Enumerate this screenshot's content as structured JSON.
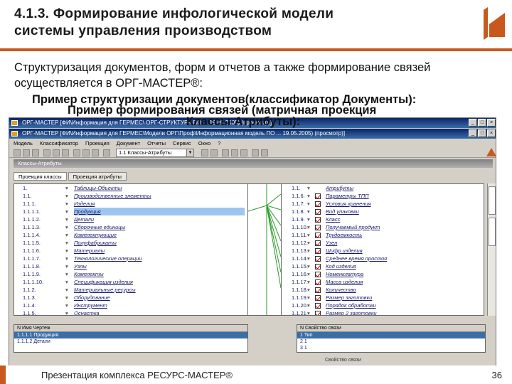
{
  "header": {
    "title_line1": "4.1.3. Формирование инфологической модели",
    "title_line2": "системы управления производством"
  },
  "intro": "Структуризация документов, форм и отчетов а также формирование связей осуществляется в ОРГ-МАСТЕР®:",
  "headings": {
    "a": "Пример структуризации документов(классификатор Документы):",
    "b": "Пример формирования связей (матричная проекция",
    "c": "Классы-Атрибуты):"
  },
  "window": {
    "title1": "ОРГ-МАСТЕР [ФИ\\Информация для ГЕРМЕС\\ ОРГ-СТРУКТУРА ПО ... 19.05.2005) (просмотр)]",
    "title2": "ОРГ-МАСТЕР [ФИ\\Информация для ГЕРМЕС\\Модели ОРГ\\Проф\\Информационная модель ПО ... 19.05.2005) (просмотр)]",
    "menu": [
      "Модель",
      "Классификатор",
      "Проекция",
      "Документ",
      "Отчеты",
      "Сервис",
      "Окно",
      "?"
    ],
    "combo": "1.1 Классы-Атрибуты",
    "subtitle": "Классы-Атрибуты",
    "tabs": [
      "Проекция классы",
      "Проекция атрибуты"
    ]
  },
  "left_rows": [
    {
      "num": "1.",
      "name": "Таблицы-Объекты"
    },
    {
      "num": "1.1.",
      "name": "Производственные элементы"
    },
    {
      "num": "1.1.1.",
      "name": "Изделия"
    },
    {
      "num": "1.1.1.1.",
      "name": "Продукция",
      "sel": true
    },
    {
      "num": "1.1.1.2.",
      "name": "Детали"
    },
    {
      "num": "1.1.1.3.",
      "name": "Сборочные единицы"
    },
    {
      "num": "1.1.1.4.",
      "name": "Комплектующие"
    },
    {
      "num": "1.1.1.5.",
      "name": "Полуфабрикаты"
    },
    {
      "num": "1.1.1.6.",
      "name": "Материалы"
    },
    {
      "num": "1.1.1.7.",
      "name": "Технологические операции"
    },
    {
      "num": "1.1.1.8.",
      "name": "Узлы"
    },
    {
      "num": "1.1.1.9.",
      "name": "Комплекты"
    },
    {
      "num": "1.1.1.10.",
      "name": "Спецификация изделия"
    },
    {
      "num": "1.1.2.",
      "name": "Материальные ресурсы"
    },
    {
      "num": "1.1.3.",
      "name": "Оборудование"
    },
    {
      "num": "1.1.4.",
      "name": "Инструмент"
    },
    {
      "num": "1.1.5.",
      "name": "Оснастка"
    }
  ],
  "right_rows": [
    {
      "num": "1.1.",
      "name": "Атрибуты"
    },
    {
      "num": "1.1.6.",
      "name": "Параметры ТПП"
    },
    {
      "num": "1.1.7.",
      "name": "Условия хранения"
    },
    {
      "num": "1.1.8.",
      "name": "Вид упаковки"
    },
    {
      "num": "1.1.9.",
      "name": "Класс"
    },
    {
      "num": "1.1.10.",
      "name": "Получаемый продукт"
    },
    {
      "num": "1.1.11.",
      "name": "Трудоемкость"
    },
    {
      "num": "1.1.12.",
      "name": "Узел"
    },
    {
      "num": "1.1.13.",
      "name": "Шифр изделия"
    },
    {
      "num": "1.1.14.",
      "name": "Среднее время простоя"
    },
    {
      "num": "1.1.15.",
      "name": "Код изделия"
    },
    {
      "num": "1.1.16.",
      "name": "Номенклатура"
    },
    {
      "num": "1.1.17.",
      "name": "Масса изделия"
    },
    {
      "num": "1.1.18.",
      "name": "Количество"
    },
    {
      "num": "1.1.19.",
      "name": "Размер заготовки"
    },
    {
      "num": "1.1.20.",
      "name": "Порядок обработки"
    },
    {
      "num": "1.1.21.",
      "name": "Размер 2 заготовки"
    }
  ],
  "bottom_left": {
    "header": "N     Имя     Чертеж",
    "rows": [
      "1.1.1.1  Продукция",
      "1.1.1.2  Детали"
    ]
  },
  "bottom_right": {
    "header": "N     Свойство связи",
    "rows": [
      "1  Тип",
      "2  1",
      "3  1",
      "4  1"
    ],
    "status": "Свойство связи"
  },
  "footer": {
    "text": "Презентация комплекса РЕСУРС-МАСТЕР®",
    "page": "36"
  },
  "colors": {
    "accent": "#c9581d",
    "titlebar": "#0a246a"
  }
}
